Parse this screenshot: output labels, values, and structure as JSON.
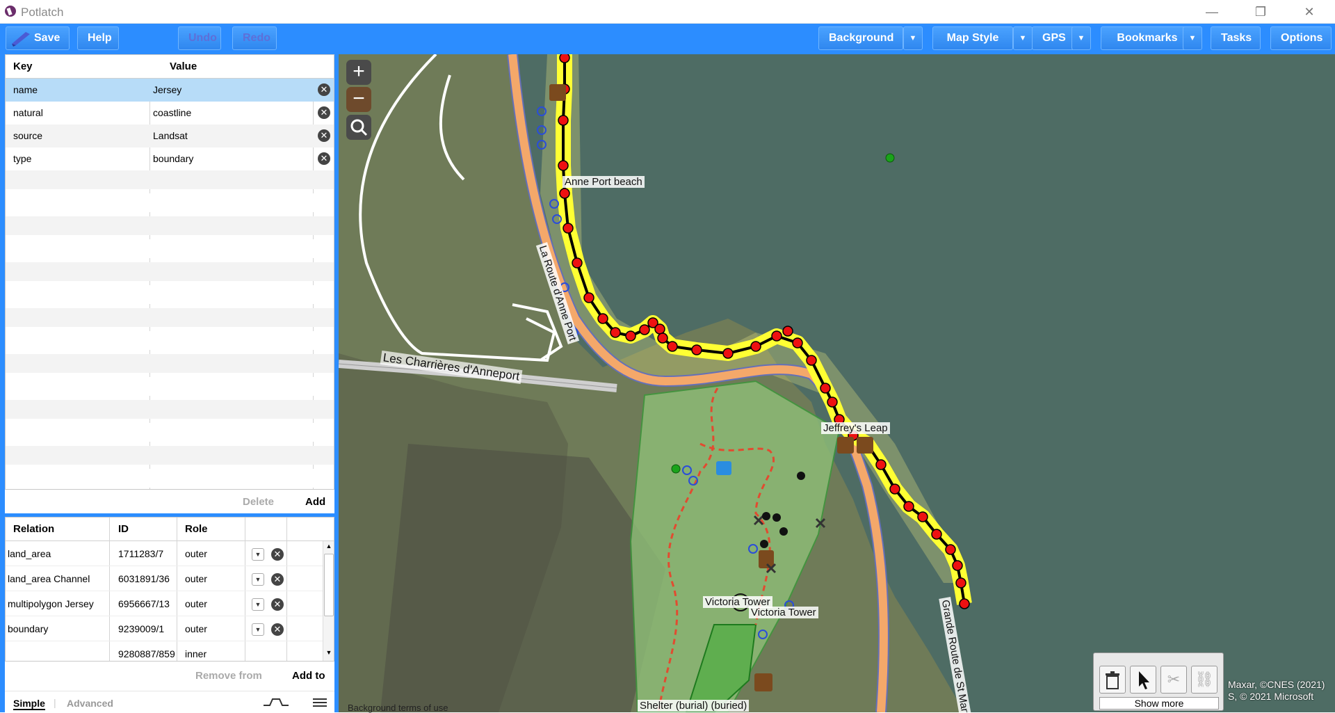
{
  "window": {
    "title": "Potlatch",
    "minimize_glyph": "—",
    "restore_glyph": "❐",
    "close_glyph": "✕"
  },
  "toolbar": {
    "save": "Save",
    "help": "Help",
    "undo": "Undo",
    "redo": "Redo",
    "background": "Background",
    "map_style": "Map Style",
    "gps": "GPS",
    "bookmarks": "Bookmarks",
    "tasks": "Tasks",
    "options": "Options",
    "dropdown_glyph": "▼"
  },
  "tag_table": {
    "header_key": "Key",
    "header_value": "Value",
    "rows": [
      {
        "key": "name",
        "value": "Jersey",
        "selected": true
      },
      {
        "key": "natural",
        "value": "coastline"
      },
      {
        "key": "source",
        "value": "Landsat"
      },
      {
        "key": "type",
        "value": "boundary"
      }
    ],
    "remove_glyph": "✕",
    "delete_label": "Delete",
    "add_label": "Add"
  },
  "relations": {
    "header_relation": "Relation",
    "header_id": "ID",
    "header_role": "Role",
    "rows": [
      {
        "relation": "land_area",
        "id": "1711283/7",
        "role": "outer"
      },
      {
        "relation": "land_area Channel",
        "id": "6031891/36",
        "role": "outer"
      },
      {
        "relation": "multipolygon Jersey",
        "id": "6956667/13",
        "role": "outer"
      },
      {
        "relation": "boundary",
        "id": "9239009/1",
        "role": "outer"
      },
      {
        "relation": "",
        "id": "9280887/859",
        "role": "inner"
      }
    ],
    "remove_from": "Remove from",
    "add_to": "Add to"
  },
  "panel_tabs": {
    "simple": "Simple",
    "advanced": "Advanced"
  },
  "map": {
    "zoom_in": "+",
    "zoom_out": "−",
    "labels": {
      "beach": "Anne Port beach",
      "road1": "La Route d'Anne Port",
      "road2": "Les Charrières d'Anneport",
      "leap": "Jeffrey's Leap",
      "tower1": "Victoria Tower",
      "tower2": "Victoria Tower",
      "road3": "Grande Route de St Martin",
      "shelter": "Shelter (burial) (buried)"
    },
    "attribution_line1": "Maxar, ©CNES (2021)",
    "attribution_line2": "S, © 2021 Microsoft",
    "terms": "Background terms of use",
    "show_more": "Show more"
  }
}
